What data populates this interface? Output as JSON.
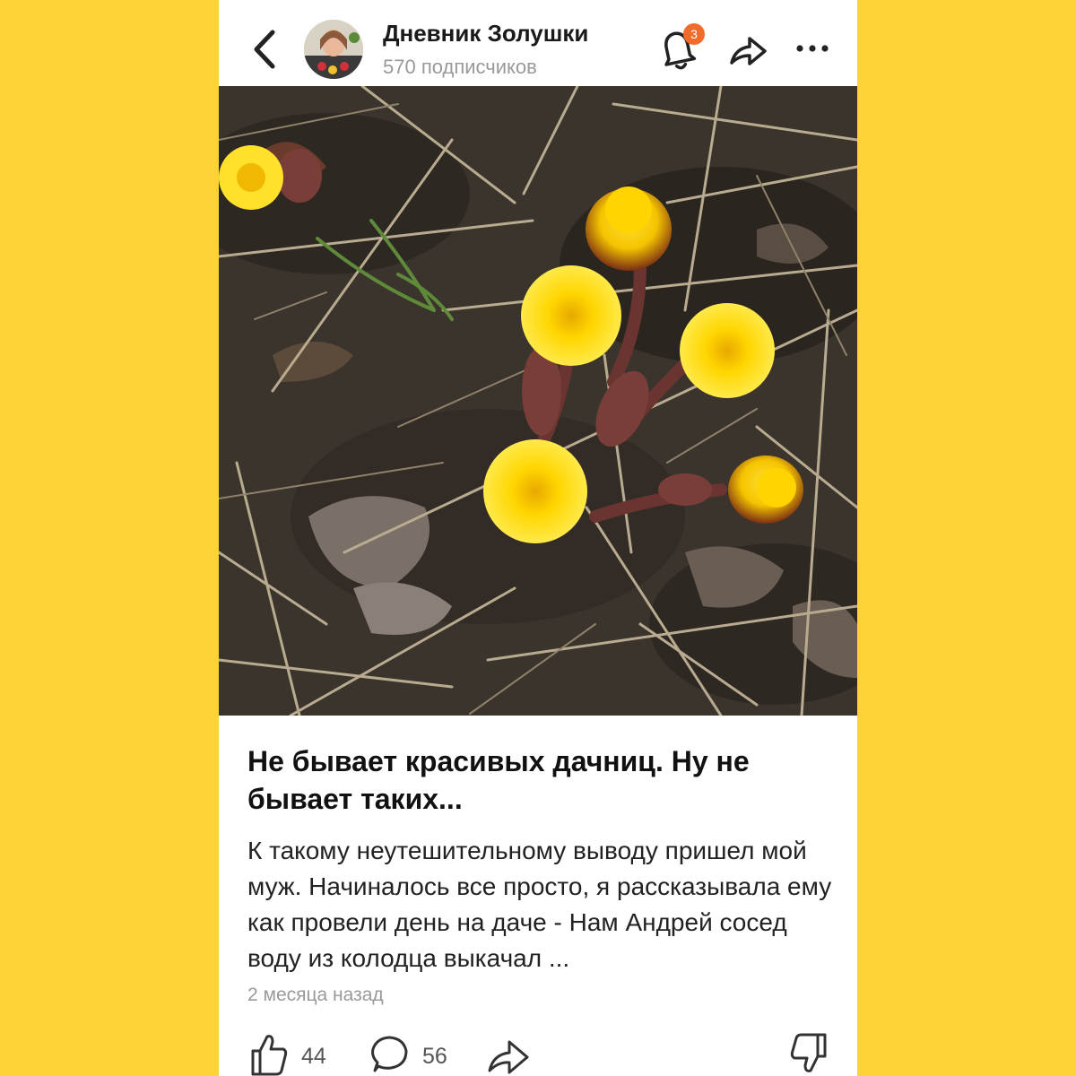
{
  "channel": {
    "name": "Дневник Золушки",
    "subscribers": "570 подписчиков",
    "notification_count": "3"
  },
  "post": {
    "title": "Не бывает красивых дачниц. Ну не бывает таких...",
    "text": "К такому неутешительному выводу пришел мой муж. Начиналось все просто, я рассказывала ему как провели день на даче - Нам Андрей сосед воду из колодца выкачал ...",
    "date": "2 месяца назад",
    "image_subject": "coltsfoot-flowers"
  },
  "actions": {
    "likes": "44",
    "comments": "56"
  },
  "icons": [
    "back-arrow-icon",
    "bell-icon",
    "share-icon",
    "more-icon",
    "like-icon",
    "comment-icon",
    "dislike-icon"
  ],
  "colors": {
    "background": "#FDD236",
    "card": "#FFFFFF",
    "badge": "#F26B2B",
    "muted_text": "#999999"
  }
}
